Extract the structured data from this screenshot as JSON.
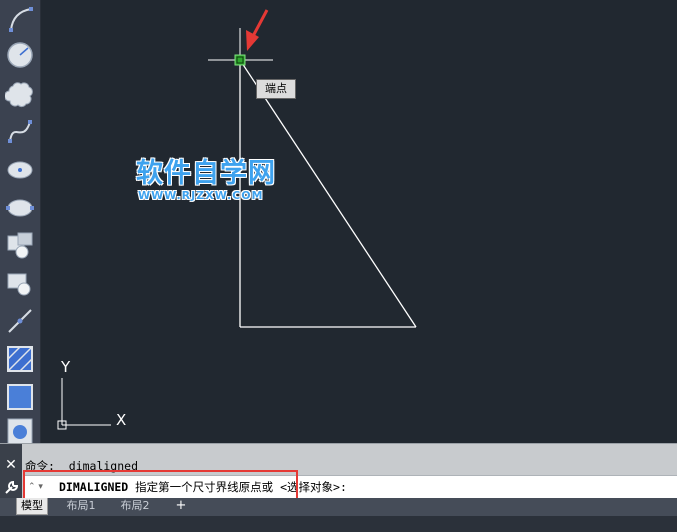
{
  "tooltip": {
    "text": "端点"
  },
  "watermark": {
    "title": "软件自学网",
    "url": "WWW.RJZXW.COM"
  },
  "ucs": {
    "x_label": "X",
    "y_label": "Y"
  },
  "command": {
    "history": "命令:  dimaligned",
    "prompt_command": "DIMALIGNED",
    "prompt_text": " 指定第一个尺寸界线原点或 <选择对象>:",
    "close_label": "✕"
  },
  "tabs": {
    "model": "模型",
    "layout1": "布局1",
    "layout2": "布局2",
    "add": "+"
  },
  "toolbar": {
    "tools": [
      "arc-tool",
      "circle-tool",
      "revision-cloud-tool",
      "spline-fit-tool",
      "ellipse-center-tool",
      "ellipse-tool",
      "insert-block-tool",
      "make-block-tool",
      "point-tool",
      "hatch-tool",
      "gradient-tool",
      "region-tool"
    ]
  },
  "colors": {
    "background": "#212830",
    "geometry": "#ffffff",
    "snap_marker": "#2fa82f",
    "annotation_arrow": "#e53935",
    "highlight": "#e53935"
  }
}
